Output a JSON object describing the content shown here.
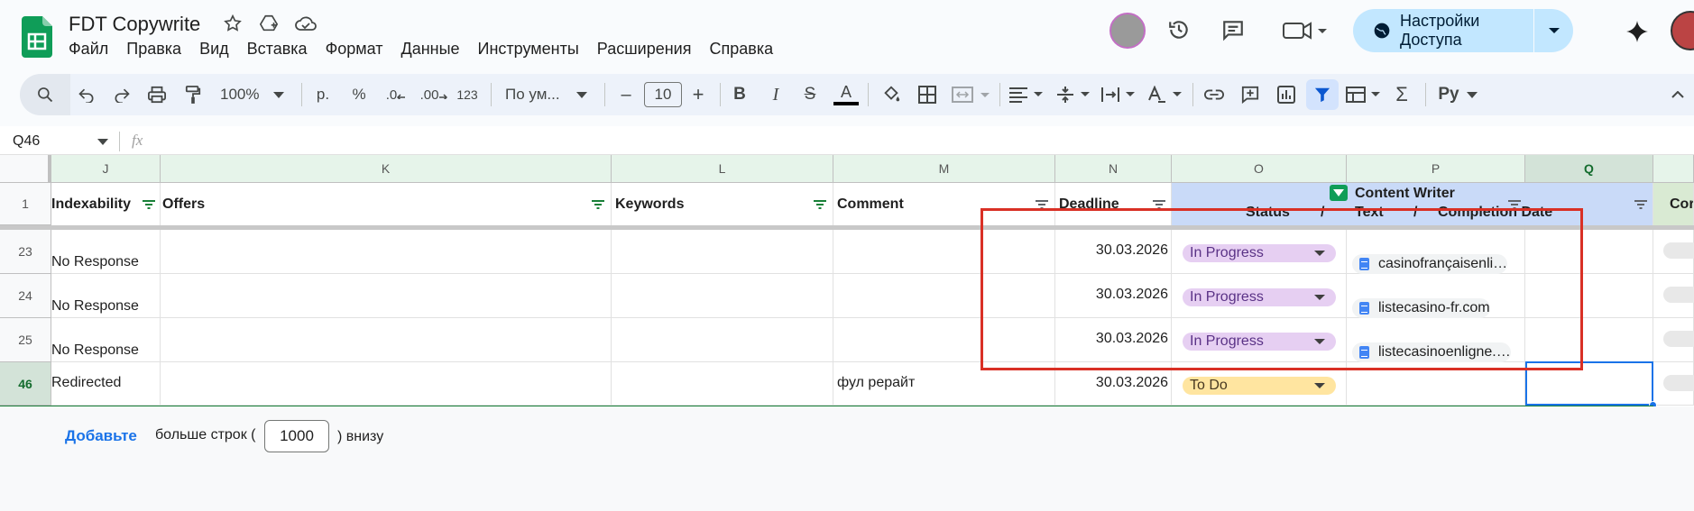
{
  "header": {
    "doc_title": "FDT Copywrite",
    "menu": [
      "Файл",
      "Правка",
      "Вид",
      "Вставка",
      "Формат",
      "Данные",
      "Инструменты",
      "Расширения",
      "Справка"
    ],
    "share_label": "Настройки Доступа"
  },
  "toolbar": {
    "zoom": "100%",
    "currency": "р.",
    "percent": "%",
    "dec_decrease": ".0",
    "dec_increase": ".00",
    "number_format": "123",
    "font": "По ум...",
    "font_size": "10",
    "minus": "–",
    "plus": "+",
    "bold": "B",
    "italic": "I",
    "strike": "S",
    "text_color": "A",
    "sigma": "Σ",
    "script": "Pу"
  },
  "formula_bar": {
    "name_box": "Q46",
    "fx": "fx"
  },
  "columns": [
    "J",
    "K",
    "L",
    "M",
    "N",
    "O",
    "P",
    "Q"
  ],
  "header_row": {
    "row_num": "1",
    "indexability": "Indexability",
    "offers": "Offers",
    "keywords": "Keywords",
    "comment": "Comment",
    "deadline": "Deadline",
    "content_writer": "Content Writer",
    "status": "Status",
    "slash1": "/",
    "text": "Text",
    "slash2": "/",
    "completion_date": "Completion Date",
    "next_col_partial": "Cor"
  },
  "rows": [
    {
      "num": "23",
      "indexability": "No Response",
      "comment": "",
      "deadline": "30.03.2026",
      "status": "In Progress",
      "doc": "casinofrançaisenli…"
    },
    {
      "num": "24",
      "indexability": "No Response",
      "comment": "",
      "deadline": "30.03.2026",
      "status": "In Progress",
      "doc": "listecasino-fr.com"
    },
    {
      "num": "25",
      "indexability": "No Response",
      "comment": "",
      "deadline": "30.03.2026",
      "status": "In Progress",
      "doc": "listecasinoenligne.…"
    },
    {
      "num": "46",
      "indexability": "Redirected",
      "comment": "фул рерайт",
      "deadline": "30.03.2026",
      "status": "To Do",
      "doc": ""
    }
  ],
  "footer": {
    "add_label": "Добавьте",
    "more_rows_text": "больше строк (",
    "rows_value": "1000",
    "below_text": ") внизу"
  },
  "colors": {
    "accent": "#1a73e8",
    "in_progress_bg": "#e6cff2",
    "in_progress_fg": "#5a3286",
    "todo_bg": "#ffe5a0",
    "todo_fg": "#473821",
    "highlight_red": "#d93025",
    "header_green": "#e6f4ea",
    "content_writer_bg": "#c9daf8"
  }
}
